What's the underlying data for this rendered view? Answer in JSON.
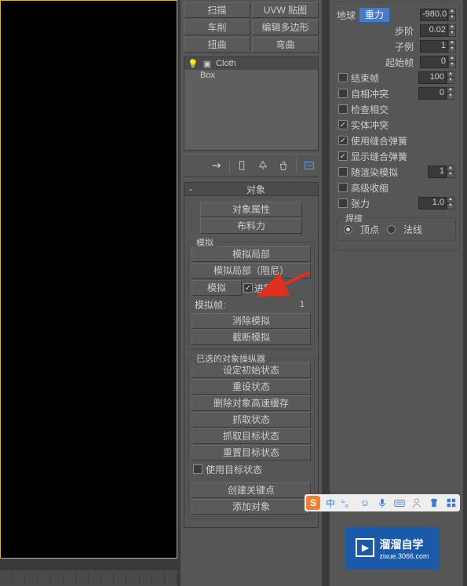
{
  "modifiers": {
    "scan": "扫描",
    "uvw": "UVW 贴图",
    "lathe": "车削",
    "edit_poly": "编辑多边形",
    "twist": "扭曲",
    "bend": "弯曲"
  },
  "stack": {
    "cloth": "Cloth",
    "box": "Box"
  },
  "rollouts": {
    "object_header": "对象",
    "object_props": "对象属性",
    "cloth_forces": "布料力",
    "sim_group": "模拟",
    "sim_local": "模拟局部",
    "sim_local_damped": "模拟局部（阻尼）",
    "simulate": "模拟",
    "progress": "进程",
    "sim_frame_label": "模拟帧:",
    "sim_frame_value": "1",
    "erase_sim": "消除模拟",
    "truncate_sim": "截断模拟",
    "selected_manip": "已选的对象操纵器",
    "set_initial": "设定初始状态",
    "reset_state": "重设状态",
    "delete_cache": "删除对象高速缓存",
    "grab_state": "抓取状态",
    "grab_target": "抓取目标状态",
    "reset_target": "重置目标状态",
    "use_target": "使用目标状态",
    "create_keys": "创建关键点",
    "add_objects": "添加对象"
  },
  "params": {
    "earth": "地球",
    "gravity": "重力",
    "gravity_val": "-980.0",
    "step": "步阶",
    "step_val": "0.02",
    "subsample": "子例",
    "subsample_val": "1",
    "start_frame": "起始帧",
    "start_frame_val": "0",
    "end_frame": "结束帧",
    "end_frame_val": "100",
    "self_collision": "自相冲突",
    "self_collision_val": "0",
    "check_intersect": "检查相交",
    "solid_collision": "实体冲突",
    "use_sewing": "使用缝合弹簧",
    "show_sewing": "显示缝合弹簧",
    "random_wind": "随渲染模拟",
    "random_wind_val": "1",
    "adv_compress": "高级收缩",
    "tension": "张力",
    "tension_val": "1.0",
    "weld_group": "焊接",
    "vertex": "顶点",
    "normal": "法线"
  },
  "ime": {
    "s": "S",
    "cn": "中"
  },
  "logo": {
    "text": "溜溜自学",
    "url": "zixue.3066.com"
  }
}
